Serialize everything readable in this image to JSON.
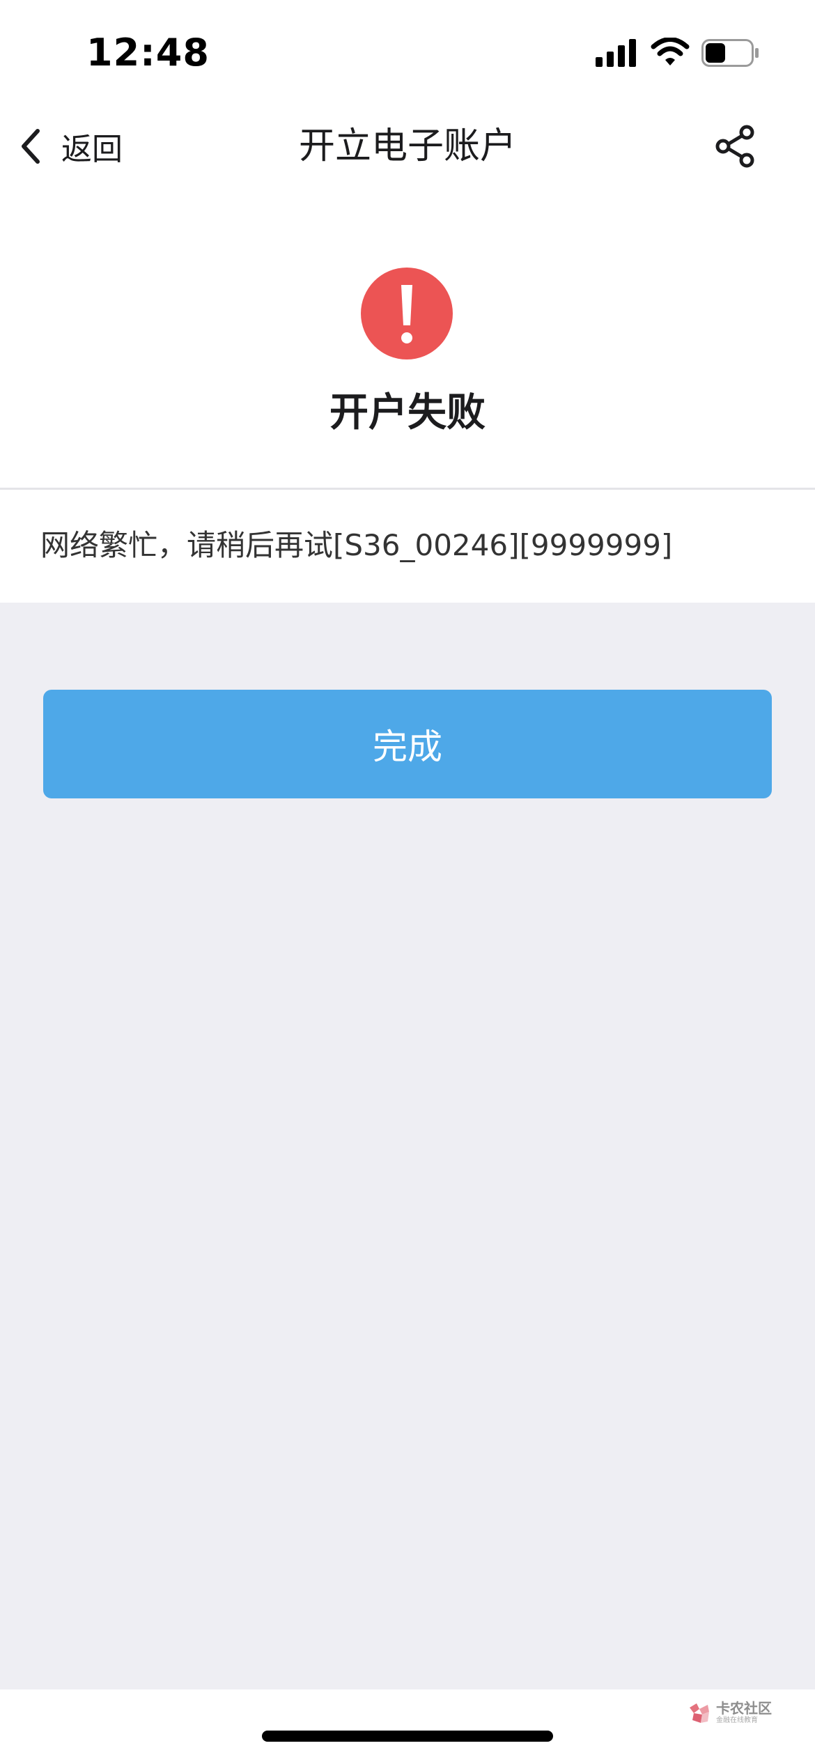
{
  "status_bar": {
    "time": "12:48",
    "icons": [
      "signal-icon",
      "wifi-icon",
      "battery-icon"
    ],
    "battery_level": 0.45
  },
  "nav": {
    "back_label": "返回",
    "title": "开立电子账户",
    "back_icon": "chevron-left-icon",
    "share_icon": "share-icon"
  },
  "result": {
    "icon": "exclamation-circle-icon",
    "title": "开户失败",
    "message": "网络繁忙，请稍后再试[S36_00246][9999999]"
  },
  "actions": {
    "done_label": "完成"
  },
  "watermark": {
    "title": "卡农社区",
    "subtitle": "金融在线教育"
  },
  "colors": {
    "primary_button": "#4ea8e8",
    "error_red": "#ec5454",
    "background": "#eeeef3",
    "surface": "#ffffff"
  }
}
